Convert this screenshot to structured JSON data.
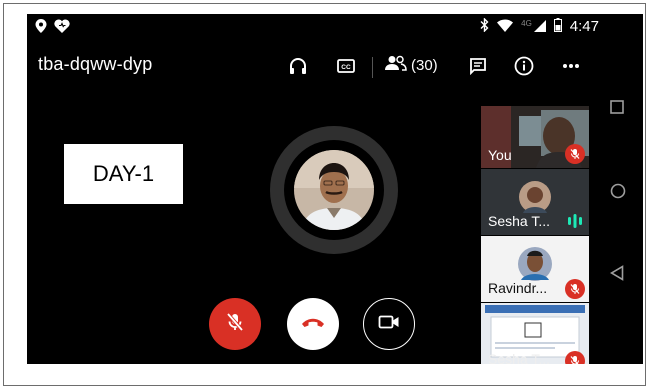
{
  "meeting": {
    "code": "tba-dqww-dyp"
  },
  "statusbar": {
    "time": "4:47",
    "network": "4G"
  },
  "toolbar": {
    "participants_count": "(30)"
  },
  "slide": {
    "label": "DAY-1"
  },
  "participants": [
    {
      "name": "You",
      "muted": true
    },
    {
      "name": "Sesha T...",
      "speaking": true
    },
    {
      "name": "Ravindr...",
      "muted": true
    },
    {
      "name": "Sesha T...",
      "muted": true
    }
  ],
  "colors": {
    "background": "#000000",
    "danger": "#d93025",
    "speaking": "#1de9b6"
  },
  "icons": {
    "status_left": [
      "location-pin-icon",
      "heart-icon"
    ],
    "status_right": [
      "bluetooth-icon",
      "wifi-icon",
      "signal-icon",
      "battery-icon"
    ],
    "toolbar": [
      "headphones-icon",
      "captions-icon",
      "people-icon",
      "chat-icon",
      "info-icon",
      "more-icon"
    ],
    "controls": [
      "mic-off-icon",
      "hang-up-icon",
      "video-camera-icon"
    ],
    "nav": [
      "recents-square-icon",
      "home-circle-icon",
      "back-triangle-icon"
    ]
  }
}
